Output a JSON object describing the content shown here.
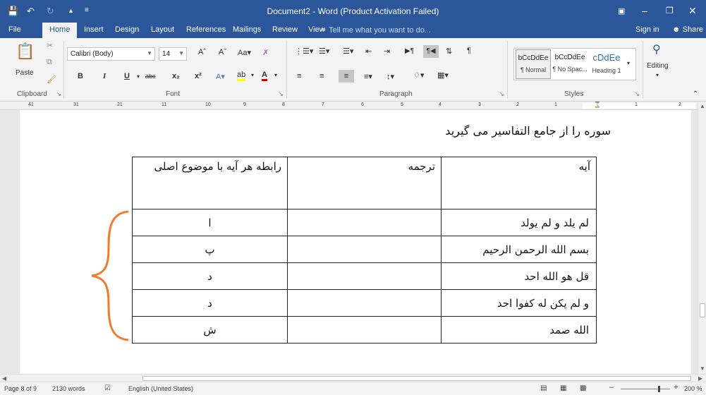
{
  "window": {
    "title": "Document2 - Word (Product Activation Failed)",
    "colors": {
      "accent": "#2b579a",
      "brace": "#ed7d31"
    }
  },
  "tabs": [
    "File",
    "Home",
    "Insert",
    "Design",
    "Layout",
    "References",
    "Mailings",
    "Review",
    "View"
  ],
  "tell_me": "Tell me what you want to do...",
  "account": {
    "sign_in": "Sign in",
    "share": "Share"
  },
  "ribbon": {
    "paste_label": "Paste",
    "font_name": "Calibri (Body)",
    "font_size": "14",
    "group_labels": {
      "clipboard": "Clipboard",
      "font": "Font",
      "paragraph": "Paragraph",
      "styles": "Styles"
    },
    "styles": [
      {
        "preview": "bCcDdEe",
        "name": "¶ Normal"
      },
      {
        "preview": "bCcDdEe",
        "name": "¶ No Spac..."
      },
      {
        "preview": "cDdEe",
        "name": "Heading 1"
      }
    ],
    "editing_label": "Editing"
  },
  "ruler": [
    "2",
    "1",
    "1",
    "2",
    "3",
    "4",
    "5",
    "6",
    "7",
    "8",
    "9",
    "10",
    "11",
    "21",
    "31",
    "41"
  ],
  "document": {
    "heading": "سوره را از جامع التفاسیر می گیرید",
    "table": {
      "headers": [
        "آیه",
        "ترجمه",
        "رابطه هر آیه با موضوع اصلی"
      ],
      "rows": [
        {
          "ayah": "لم یلد و لم یولد",
          "translation": "",
          "relation": "ا"
        },
        {
          "ayah": "بسم الله الرحمن الرحیم",
          "translation": "",
          "relation": "پ"
        },
        {
          "ayah": "قل هو الله احد",
          "translation": "",
          "relation": "د"
        },
        {
          "ayah": "و لم یکن له کفوا احد",
          "translation": "",
          "relation": "د"
        },
        {
          "ayah": "الله صمد",
          "translation": "",
          "relation": "ش"
        }
      ]
    }
  },
  "status": {
    "page": "Page 8 of 9",
    "words": "2130 words",
    "language": "English (United States)",
    "zoom": "200 %"
  }
}
